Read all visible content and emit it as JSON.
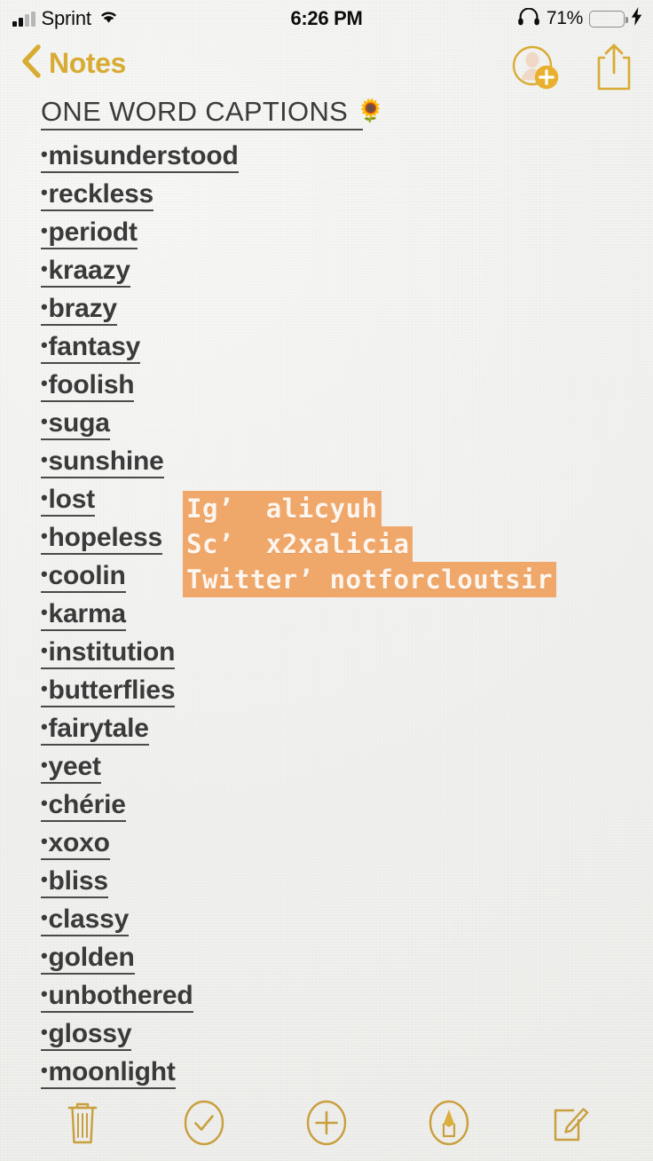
{
  "status_bar": {
    "carrier": "Sprint",
    "signal_icon": "signal-bars-icon",
    "wifi_icon": "wifi-icon",
    "time": "6:26 PM",
    "headphones_icon": "headphones-icon",
    "battery_percent": "71%",
    "battery_level": 71,
    "battery_color": "#4cd660",
    "charging_icon": "lightning-bolt-icon"
  },
  "nav_bar": {
    "back_label": "Notes",
    "back_icon": "chevron-left-icon",
    "accent_color": "#d8ab33",
    "add_person_icon": "add-person-icon",
    "share_icon": "share-icon"
  },
  "note": {
    "title": "ONE WORD CAPTIONS",
    "title_emoji": "🌻",
    "bullet": "•",
    "items": [
      "misunderstood",
      "reckless",
      "periodt",
      "kraazy",
      "brazy",
      "fantasy",
      "foolish",
      "suga",
      "sunshine",
      "lost",
      "hopeless",
      "coolin",
      "karma",
      "institution",
      "butterflies",
      "fairytale",
      "yeet",
      "chérie",
      "xoxo",
      "bliss",
      "classy",
      "golden",
      "unbothered",
      "glossy",
      "moonlight"
    ]
  },
  "overlay": {
    "highlight_color": "#f0a76a",
    "text_color": "#fdf6ee",
    "lines": [
      "Ig’  alicyuh",
      "Sc’  x2xalicia",
      "Twitter’ notforcloutsir"
    ]
  },
  "toolbar": {
    "accent_color": "#c99f3e",
    "buttons": [
      {
        "name": "delete-button",
        "icon": "trash-icon"
      },
      {
        "name": "checklist-button",
        "icon": "check-circle-icon"
      },
      {
        "name": "add-attachment-button",
        "icon": "plus-circle-icon"
      },
      {
        "name": "markup-button",
        "icon": "pen-circle-icon"
      },
      {
        "name": "compose-button",
        "icon": "compose-icon"
      }
    ]
  }
}
